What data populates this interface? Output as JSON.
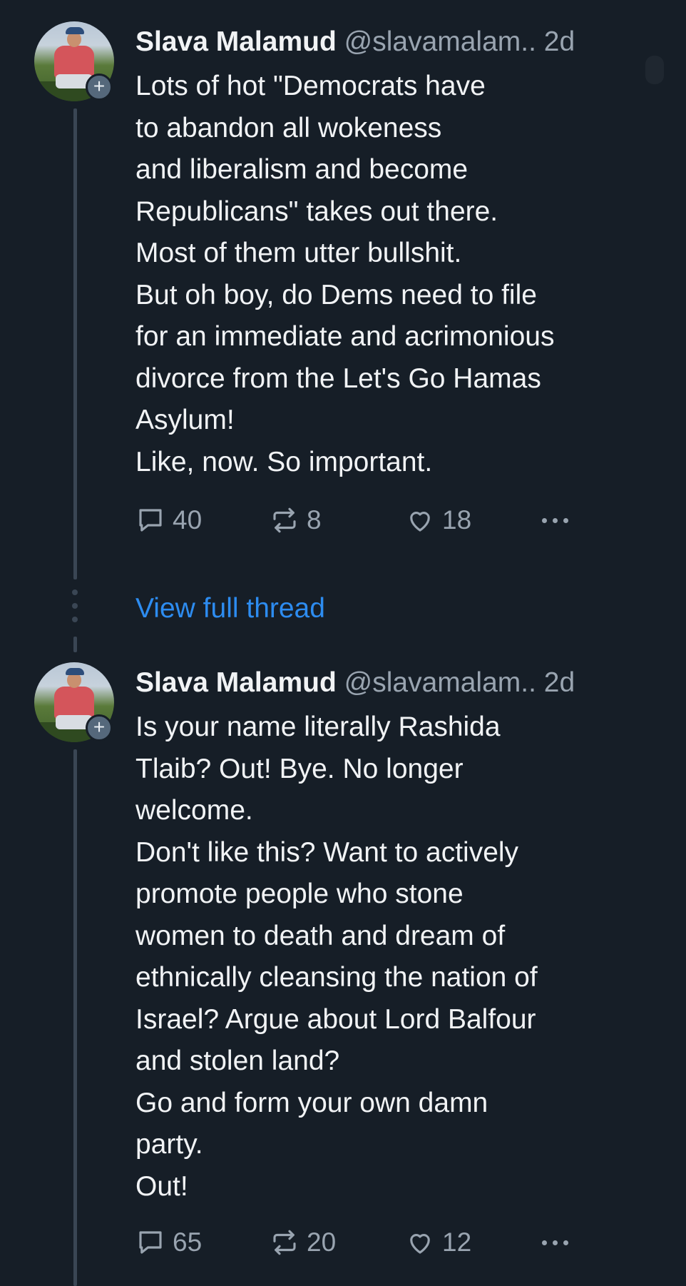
{
  "posts": [
    {
      "author": "Slava Malamud",
      "handle": "@slavamalam..",
      "age": "2d",
      "follow_badge": "+",
      "text": "Lots of hot \"Democrats have\nto abandon all wokeness\nand liberalism and become\nRepublicans\" takes out there.\nMost of them utter bullshit.\nBut oh boy, do Dems need to file\nfor an immediate and acrimonious\ndivorce from the Let's Go Hamas\nAsylum!\nLike, now. So important.",
      "replies": "40",
      "reposts": "8",
      "likes": "18"
    },
    {
      "author": "Slava Malamud",
      "handle": "@slavamalam..",
      "age": "2d",
      "follow_badge": "+",
      "text": "Is your name literally Rashida\nTlaib? Out! Bye. No longer\nwelcome.\nDon't like this? Want to actively\npromote people who stone\nwomen to death and dream of\nethnically cleansing the nation of\nIsrael? Argue about Lord Balfour\nand stolen land?\nGo and form your own damn\nparty.\nOut!",
      "replies": "65",
      "reposts": "20",
      "likes": "12"
    }
  ],
  "view_full_thread": "View full thread",
  "icons": [
    "reply-icon",
    "repost-icon",
    "like-icon",
    "more-icon"
  ],
  "colors": {
    "background": "#161e27",
    "link": "#2d8cf0",
    "muted": "#99a4b0"
  }
}
